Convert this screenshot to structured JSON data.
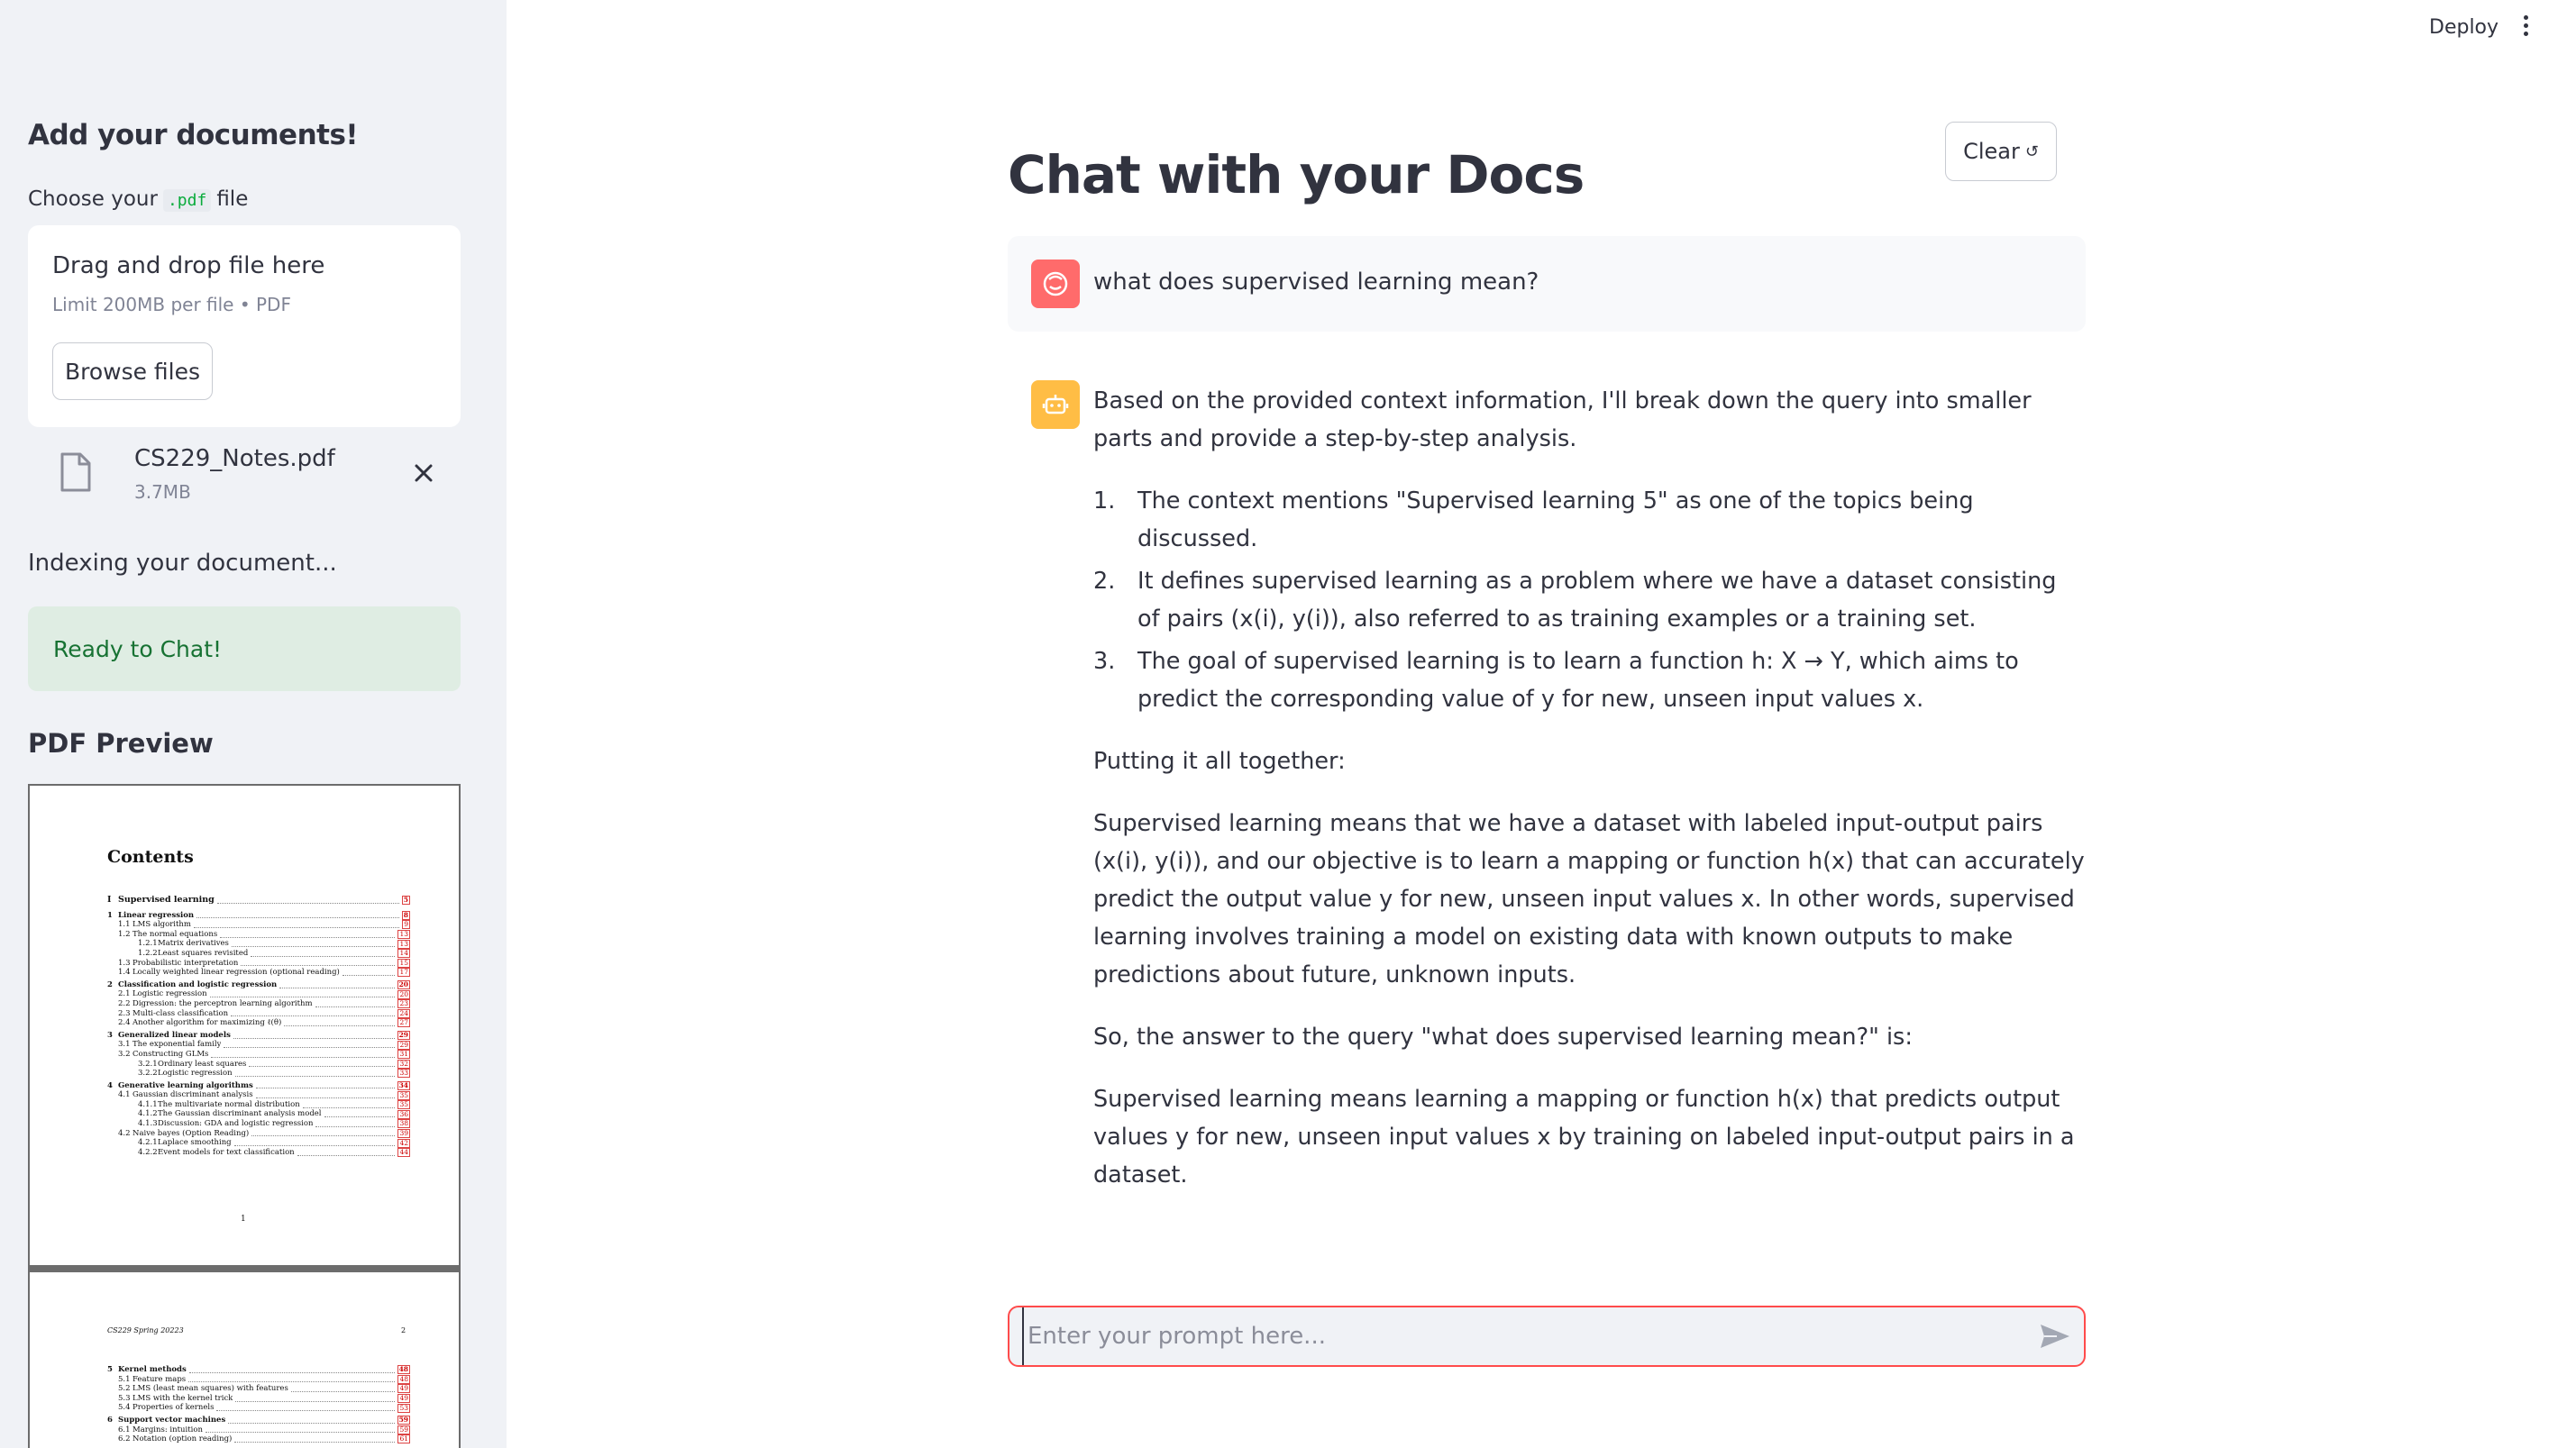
{
  "sidebar": {
    "title": "Add your documents!",
    "choose_prefix": "Choose your",
    "choose_code": ".pdf",
    "choose_suffix": "file",
    "dropzone": {
      "title": "Drag and drop file here",
      "limit": "Limit 200MB per file • PDF",
      "browse_label": "Browse files"
    },
    "file": {
      "name": "CS229_Notes.pdf",
      "size": "3.7MB",
      "icon": "file-icon",
      "close_icon": "close-icon"
    },
    "indexing_text": "Indexing your document...",
    "ready_text": "Ready to Chat!",
    "pdf_preview_title": "PDF Preview",
    "pdf": {
      "page1": {
        "heading": "Contents",
        "page_number": "1",
        "toc": [
          {
            "level": "part",
            "num": "I",
            "text": "Supervised learning",
            "page": "5"
          },
          {
            "level": "sec",
            "num": "1",
            "text": "Linear regression",
            "page": "8"
          },
          {
            "level": "sub",
            "num": "1.1",
            "text": "LMS algorithm",
            "page": "9"
          },
          {
            "level": "sub",
            "num": "1.2",
            "text": "The normal equations",
            "page": "13"
          },
          {
            "level": "subsub",
            "num": "1.2.1",
            "text": "Matrix derivatives",
            "page": "13"
          },
          {
            "level": "subsub",
            "num": "1.2.2",
            "text": "Least squares revisited",
            "page": "14"
          },
          {
            "level": "sub",
            "num": "1.3",
            "text": "Probabilistic interpretation",
            "page": "15"
          },
          {
            "level": "sub",
            "num": "1.4",
            "text": "Locally weighted linear regression (optional reading)",
            "page": "17"
          },
          {
            "level": "sec",
            "num": "2",
            "text": "Classification and logistic regression",
            "page": "20"
          },
          {
            "level": "sub",
            "num": "2.1",
            "text": "Logistic regression",
            "page": "20"
          },
          {
            "level": "sub",
            "num": "2.2",
            "text": "Digression: the perceptron learning algorithm",
            "page": "23"
          },
          {
            "level": "sub",
            "num": "2.3",
            "text": "Multi-class classification",
            "page": "24"
          },
          {
            "level": "sub",
            "num": "2.4",
            "text": "Another algorithm for maximizing ℓ(θ)",
            "page": "27"
          },
          {
            "level": "sec",
            "num": "3",
            "text": "Generalized linear models",
            "page": "29"
          },
          {
            "level": "sub",
            "num": "3.1",
            "text": "The exponential family",
            "page": "29"
          },
          {
            "level": "sub",
            "num": "3.2",
            "text": "Constructing GLMs",
            "page": "31"
          },
          {
            "level": "subsub",
            "num": "3.2.1",
            "text": "Ordinary least squares",
            "page": "32"
          },
          {
            "level": "subsub",
            "num": "3.2.2",
            "text": "Logistic regression",
            "page": "33"
          },
          {
            "level": "sec",
            "num": "4",
            "text": "Generative learning algorithms",
            "page": "34"
          },
          {
            "level": "sub",
            "num": "4.1",
            "text": "Gaussian discriminant analysis",
            "page": "35"
          },
          {
            "level": "subsub",
            "num": "4.1.1",
            "text": "The multivariate normal distribution",
            "page": "35"
          },
          {
            "level": "subsub",
            "num": "4.1.2",
            "text": "The Gaussian discriminant analysis model",
            "page": "36"
          },
          {
            "level": "subsub",
            "num": "4.1.3",
            "text": "Discussion: GDA and logistic regression",
            "page": "38"
          },
          {
            "level": "sub",
            "num": "4.2",
            "text": "Naive bayes (Option Reading)",
            "page": "39"
          },
          {
            "level": "subsub",
            "num": "4.2.1",
            "text": "Laplace smoothing",
            "page": "42"
          },
          {
            "level": "subsub",
            "num": "4.2.2",
            "text": "Event models for text classification",
            "page": "44"
          }
        ]
      },
      "page2": {
        "header": "CS229 Spring 20223",
        "page_number": "2",
        "toc": [
          {
            "level": "sec",
            "num": "5",
            "text": "Kernel methods",
            "page": "48"
          },
          {
            "level": "sub",
            "num": "5.1",
            "text": "Feature maps",
            "page": "48"
          },
          {
            "level": "sub",
            "num": "5.2",
            "text": "LMS (least mean squares) with features",
            "page": "49"
          },
          {
            "level": "sub",
            "num": "5.3",
            "text": "LMS with the kernel trick",
            "page": "49"
          },
          {
            "level": "sub",
            "num": "5.4",
            "text": "Properties of kernels",
            "page": "53"
          },
          {
            "level": "sec",
            "num": "6",
            "text": "Support vector machines",
            "page": "59"
          },
          {
            "level": "sub",
            "num": "6.1",
            "text": "Margins: intuition",
            "page": "59"
          },
          {
            "level": "sub",
            "num": "6.2",
            "text": "Notation (option reading)",
            "page": "61"
          }
        ]
      }
    }
  },
  "header": {
    "deploy_label": "Deploy",
    "menu_icon": "more-vertical-icon"
  },
  "main": {
    "title": "Chat with your Docs",
    "clear_label": "Clear",
    "clear_icon": "↺",
    "messages": {
      "user": {
        "avatar_icon": "user-avatar-icon",
        "text": "what does supervised learning mean?"
      },
      "assistant": {
        "avatar_icon": "bot-avatar-icon",
        "intro": "Based on the provided context information, I'll break down the query into smaller parts and provide a step-by-step analysis.",
        "steps": [
          {
            "n": "1.",
            "text": "The context mentions \"Supervised learning 5\" as one of the topics being discussed."
          },
          {
            "n": "2.",
            "text": "It defines supervised learning as a problem where we have a dataset consisting of pairs (x(i), y(i)), also referred to as training examples or a training set."
          },
          {
            "n": "3.",
            "text": "The goal of supervised learning is to learn a function h: X → Y, which aims to predict the corresponding value of y for new, unseen input values x."
          }
        ],
        "p1": "Putting it all together:",
        "p2": "Supervised learning means that we have a dataset with labeled input-output pairs (x(i), y(i)), and our objective is to learn a mapping or function h(x) that can accurately predict the output value y for new, unseen input values x. In other words, supervised learning involves training a model on existing data with known outputs to make predictions about future, unknown inputs.",
        "p3": "So, the answer to the query \"what does supervised learning mean?\" is:",
        "p4": "Supervised learning means learning a mapping or function h(x) that predicts output values y for new, unseen input values x by training on labeled input-output pairs in a dataset."
      }
    },
    "prompt": {
      "placeholder": "Enter your prompt here...",
      "value": "",
      "send_icon": "send-icon"
    }
  },
  "colors": {
    "sidebar_bg": "#f0f2f6",
    "accent_red": "#ff4b4b",
    "success_bg": "#dfede3",
    "success_text": "#177233",
    "user_avatar": "#ff6b6b",
    "bot_avatar": "#ffbd45"
  }
}
